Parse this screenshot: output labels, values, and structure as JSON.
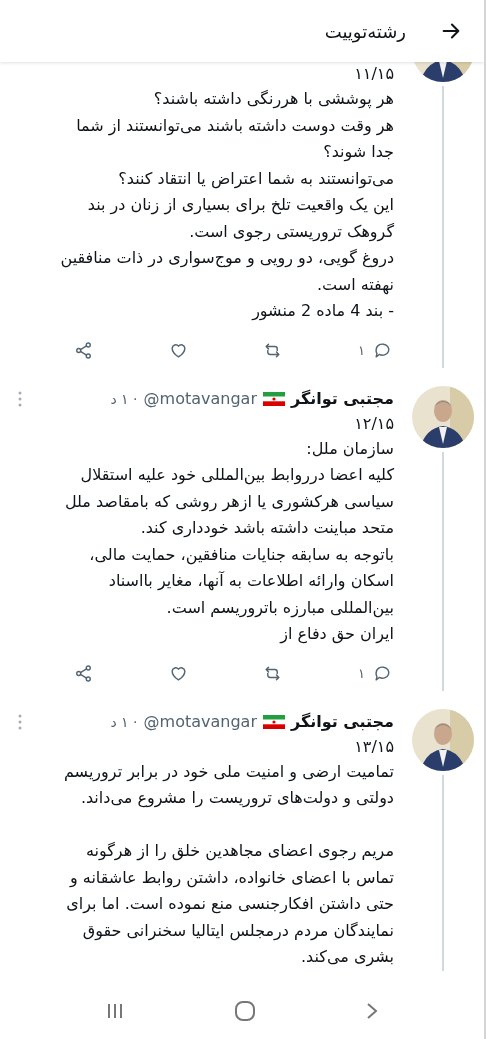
{
  "header": {
    "title": "رشته‌توییت"
  },
  "tweets": [
    {
      "truncated_top": true,
      "date": "۱۱/۱۵",
      "body": "هر پوششی با هررنگی داشته باشند؟\nهر وقت دوست داشته باشند می‌توانستند از شما\nجدا شوند؟\nمی‌توانستند به شما اعتراض یا انتقاد کنند؟\nاین یک واقعیت تلخ برای بسیاری از زنان در بند\nگروهک تروریستی رجوی است.\nدروغ گویی، دو رویی و موج‌سواری در ذات منافقین\nنهفته است.\n- بند 4 ماده 2 منشور",
      "reply_count": "۱"
    },
    {
      "truncated_top": false,
      "name": "مجتبی توانگر",
      "handle": "@motavangar",
      "time": "· ۱ د",
      "date": "۱۲/۱۵",
      "body": "سازمان ملل:\nکلیه اعضا درروابط بین‌المللی خود علیه استقلال\nسیاسی هرکشوری یا ازهر روشی که بامقاصد ملل\nمتحد مباینت داشته باشد خودداری کند.\nباتوجه به سابقه جنایات منافقین، حمایت مالی،\nاسکان وارائه اطلاعات به آنها، مغایر بااسناد\nبین‌المللی مبارزه باتروریسم است.\nایران حق دفاع از",
      "reply_count": "۱"
    },
    {
      "truncated_top": false,
      "name": "مجتبی توانگر",
      "handle": "@motavangar",
      "time": "· ۱ د",
      "date": "۱۳/۱۵",
      "body": "تمامیت ارضی و امنیت ملی خود در برابر تروریسم\nدولتی و دولت‌های تروریست را مشروع می‌داند.\n\nمریم رجوی اعضای مجاهدین خلق را از هرگونه\nتماس با اعضای خانواده، داشتن روابط عاشقانه و\nحتی داشتن افکارجنسی منع نموده است. اما برای\nنمایندگان مردم درمجلس ایتالیا سخنرانی حقوق\nبشری می‌کند."
    }
  ]
}
